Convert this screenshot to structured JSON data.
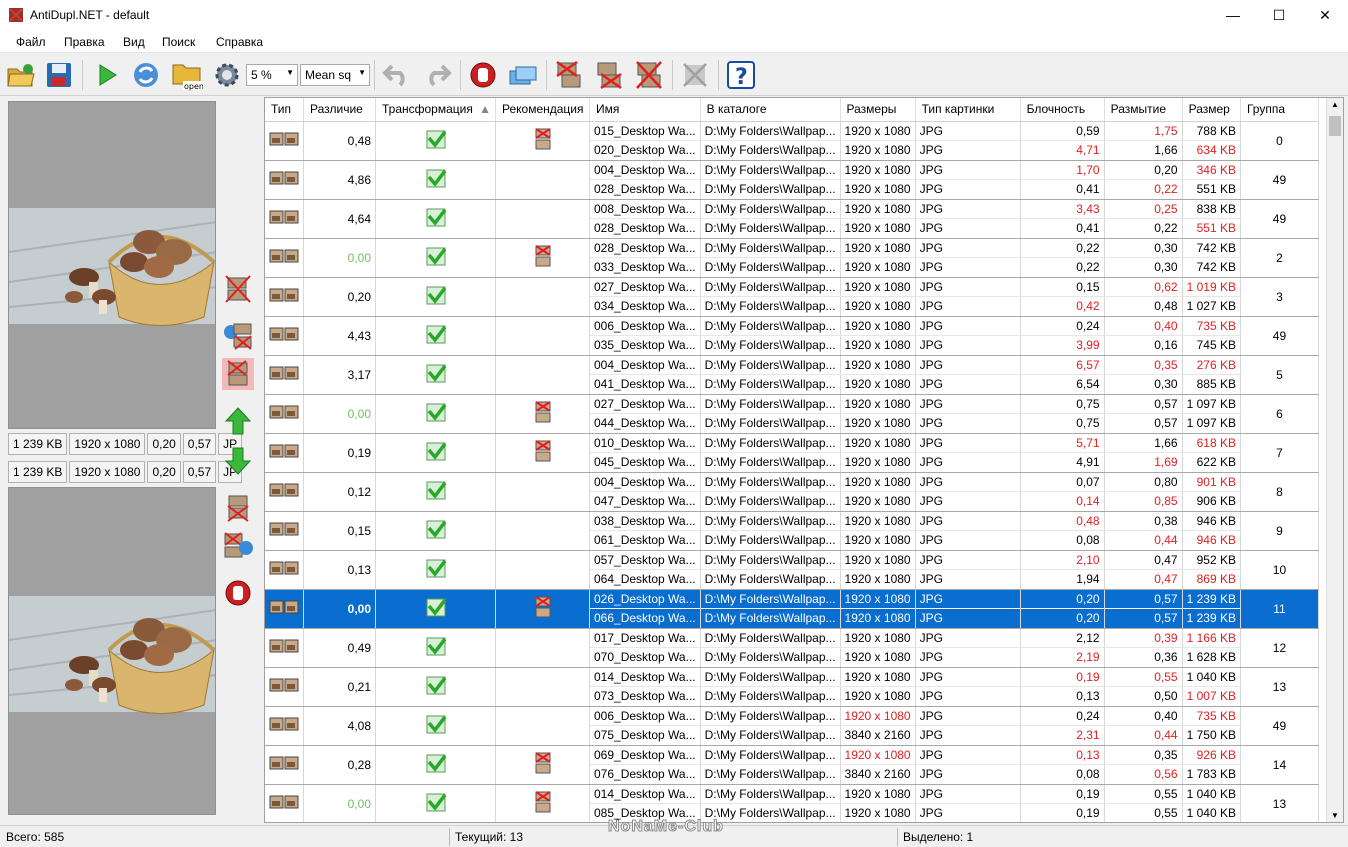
{
  "window": {
    "title": "AntiDupl.NET - default",
    "minimize": "—",
    "maximize": "☐",
    "close": "✕"
  },
  "menu": [
    "Файл",
    "Правка",
    "Вид",
    "Поиск",
    "Справка"
  ],
  "toolbar": {
    "threshold": "5 %",
    "algorithm": "Mean sq",
    "open_label": "open"
  },
  "left": {
    "top_info": [
      "1 239 KB",
      "1920 x 1080",
      "0,20",
      "0,57",
      "JP"
    ],
    "bottom_info": [
      "1 239 KB",
      "1920 x 1080",
      "0,20",
      "0,57",
      "JP"
    ]
  },
  "columns": [
    "Тип",
    "Различие",
    "Трансформация",
    "Рекомендация",
    "Имя",
    "В каталоге",
    "Размеры",
    "Тип картинки",
    "Блочность",
    "Размытие",
    "Размер",
    "Группа"
  ],
  "groups": [
    {
      "diff": "0,48",
      "dg": false,
      "rec": true,
      "group": "0",
      "sel": false,
      "a": {
        "name": "015_Desktop  Wa...",
        "dir": "D:\\My  Folders\\Wallpap...",
        "dim": "1920 x 1080",
        "dimr": false,
        "type": "JPG",
        "bl": "0,59",
        "blr": false,
        "bu": "1,75",
        "bur": true,
        "sz": "788 KB",
        "szr": false
      },
      "b": {
        "name": "020_Desktop  Wa...",
        "dir": "D:\\My  Folders\\Wallpap...",
        "dim": "1920 x 1080",
        "dimr": false,
        "type": "JPG",
        "bl": "4,71",
        "blr": true,
        "bu": "1,66",
        "bur": false,
        "sz": "634 KB",
        "szr": true
      }
    },
    {
      "diff": "4,86",
      "dg": false,
      "rec": false,
      "group": "49",
      "sel": false,
      "a": {
        "name": "004_Desktop  Wa...",
        "dir": "D:\\My  Folders\\Wallpap...",
        "dim": "1920 x 1080",
        "dimr": false,
        "type": "JPG",
        "bl": "1,70",
        "blr": true,
        "bu": "0,20",
        "bur": false,
        "sz": "346 KB",
        "szr": true
      },
      "b": {
        "name": "028_Desktop  Wa...",
        "dir": "D:\\My  Folders\\Wallpap...",
        "dim": "1920 x 1080",
        "dimr": false,
        "type": "JPG",
        "bl": "0,41",
        "blr": false,
        "bu": "0,22",
        "bur": true,
        "sz": "551 KB",
        "szr": false
      }
    },
    {
      "diff": "4,64",
      "dg": false,
      "rec": false,
      "group": "49",
      "sel": false,
      "a": {
        "name": "008_Desktop  Wa...",
        "dir": "D:\\My  Folders\\Wallpap...",
        "dim": "1920 x 1080",
        "dimr": false,
        "type": "JPG",
        "bl": "3,43",
        "blr": true,
        "bu": "0,25",
        "bur": true,
        "sz": "838 KB",
        "szr": false
      },
      "b": {
        "name": "028_Desktop  Wa...",
        "dir": "D:\\My  Folders\\Wallpap...",
        "dim": "1920 x 1080",
        "dimr": false,
        "type": "JPG",
        "bl": "0,41",
        "blr": false,
        "bu": "0,22",
        "bur": false,
        "sz": "551 KB",
        "szr": true
      }
    },
    {
      "diff": "0,00",
      "dg": true,
      "rec": true,
      "group": "2",
      "sel": false,
      "a": {
        "name": "028_Desktop  Wa...",
        "dir": "D:\\My  Folders\\Wallpap...",
        "dim": "1920 x 1080",
        "dimr": false,
        "type": "JPG",
        "bl": "0,22",
        "blr": false,
        "bu": "0,30",
        "bur": false,
        "sz": "742 KB",
        "szr": false
      },
      "b": {
        "name": "033_Desktop  Wa...",
        "dir": "D:\\My  Folders\\Wallpap...",
        "dim": "1920 x 1080",
        "dimr": false,
        "type": "JPG",
        "bl": "0,22",
        "blr": false,
        "bu": "0,30",
        "bur": false,
        "sz": "742 KB",
        "szr": false
      }
    },
    {
      "diff": "0,20",
      "dg": false,
      "rec": false,
      "group": "3",
      "sel": false,
      "a": {
        "name": "027_Desktop  Wa...",
        "dir": "D:\\My  Folders\\Wallpap...",
        "dim": "1920 x 1080",
        "dimr": false,
        "type": "JPG",
        "bl": "0,15",
        "blr": false,
        "bu": "0,62",
        "bur": true,
        "sz": "1 019 KB",
        "szr": true
      },
      "b": {
        "name": "034_Desktop  Wa...",
        "dir": "D:\\My  Folders\\Wallpap...",
        "dim": "1920 x 1080",
        "dimr": false,
        "type": "JPG",
        "bl": "0,42",
        "blr": true,
        "bu": "0,48",
        "bur": false,
        "sz": "1 027 KB",
        "szr": false
      }
    },
    {
      "diff": "4,43",
      "dg": false,
      "rec": false,
      "group": "49",
      "sel": false,
      "a": {
        "name": "006_Desktop  Wa...",
        "dir": "D:\\My  Folders\\Wallpap...",
        "dim": "1920 x 1080",
        "dimr": false,
        "type": "JPG",
        "bl": "0,24",
        "blr": false,
        "bu": "0,40",
        "bur": true,
        "sz": "735 KB",
        "szr": true
      },
      "b": {
        "name": "035_Desktop  Wa...",
        "dir": "D:\\My  Folders\\Wallpap...",
        "dim": "1920 x 1080",
        "dimr": false,
        "type": "JPG",
        "bl": "3,99",
        "blr": true,
        "bu": "0,16",
        "bur": false,
        "sz": "745 KB",
        "szr": false
      }
    },
    {
      "diff": "3,17",
      "dg": false,
      "rec": false,
      "group": "5",
      "sel": false,
      "a": {
        "name": "004_Desktop  Wa...",
        "dir": "D:\\My  Folders\\Wallpap...",
        "dim": "1920 x 1080",
        "dimr": false,
        "type": "JPG",
        "bl": "6,57",
        "blr": true,
        "bu": "0,35",
        "bur": true,
        "sz": "276 KB",
        "szr": true
      },
      "b": {
        "name": "041_Desktop  Wa...",
        "dir": "D:\\My  Folders\\Wallpap...",
        "dim": "1920 x 1080",
        "dimr": false,
        "type": "JPG",
        "bl": "6,54",
        "blr": false,
        "bu": "0,30",
        "bur": false,
        "sz": "885 KB",
        "szr": false
      }
    },
    {
      "diff": "0,00",
      "dg": true,
      "rec": true,
      "group": "6",
      "sel": false,
      "a": {
        "name": "027_Desktop  Wa...",
        "dir": "D:\\My  Folders\\Wallpap...",
        "dim": "1920 x 1080",
        "dimr": false,
        "type": "JPG",
        "bl": "0,75",
        "blr": false,
        "bu": "0,57",
        "bur": false,
        "sz": "1 097 KB",
        "szr": false
      },
      "b": {
        "name": "044_Desktop  Wa...",
        "dir": "D:\\My  Folders\\Wallpap...",
        "dim": "1920 x 1080",
        "dimr": false,
        "type": "JPG",
        "bl": "0,75",
        "blr": false,
        "bu": "0,57",
        "bur": false,
        "sz": "1 097 KB",
        "szr": false
      }
    },
    {
      "diff": "0,19",
      "dg": false,
      "rec": true,
      "group": "7",
      "sel": false,
      "a": {
        "name": "010_Desktop  Wa...",
        "dir": "D:\\My  Folders\\Wallpap...",
        "dim": "1920 x 1080",
        "dimr": false,
        "type": "JPG",
        "bl": "5,71",
        "blr": true,
        "bu": "1,66",
        "bur": false,
        "sz": "618 KB",
        "szr": true
      },
      "b": {
        "name": "045_Desktop  Wa...",
        "dir": "D:\\My  Folders\\Wallpap...",
        "dim": "1920 x 1080",
        "dimr": false,
        "type": "JPG",
        "bl": "4,91",
        "blr": false,
        "bu": "1,69",
        "bur": true,
        "sz": "622 KB",
        "szr": false
      }
    },
    {
      "diff": "0,12",
      "dg": false,
      "rec": false,
      "group": "8",
      "sel": false,
      "a": {
        "name": "004_Desktop  Wa...",
        "dir": "D:\\My  Folders\\Wallpap...",
        "dim": "1920 x 1080",
        "dimr": false,
        "type": "JPG",
        "bl": "0,07",
        "blr": false,
        "bu": "0,80",
        "bur": false,
        "sz": "901 KB",
        "szr": true
      },
      "b": {
        "name": "047_Desktop  Wa...",
        "dir": "D:\\My  Folders\\Wallpap...",
        "dim": "1920 x 1080",
        "dimr": false,
        "type": "JPG",
        "bl": "0,14",
        "blr": true,
        "bu": "0,85",
        "bur": true,
        "sz": "906 KB",
        "szr": false
      }
    },
    {
      "diff": "0,15",
      "dg": false,
      "rec": false,
      "group": "9",
      "sel": false,
      "a": {
        "name": "038_Desktop  Wa...",
        "dir": "D:\\My  Folders\\Wallpap...",
        "dim": "1920 x 1080",
        "dimr": false,
        "type": "JPG",
        "bl": "0,48",
        "blr": true,
        "bu": "0,38",
        "bur": false,
        "sz": "946 KB",
        "szr": false
      },
      "b": {
        "name": "061_Desktop  Wa...",
        "dir": "D:\\My  Folders\\Wallpap...",
        "dim": "1920 x 1080",
        "dimr": false,
        "type": "JPG",
        "bl": "0,08",
        "blr": false,
        "bu": "0,44",
        "bur": true,
        "sz": "946 KB",
        "szr": true
      }
    },
    {
      "diff": "0,13",
      "dg": false,
      "rec": false,
      "group": "10",
      "sel": false,
      "a": {
        "name": "057_Desktop  Wa...",
        "dir": "D:\\My  Folders\\Wallpap...",
        "dim": "1920 x 1080",
        "dimr": false,
        "type": "JPG",
        "bl": "2,10",
        "blr": true,
        "bu": "0,47",
        "bur": false,
        "sz": "952 KB",
        "szr": false
      },
      "b": {
        "name": "064_Desktop  Wa...",
        "dir": "D:\\My  Folders\\Wallpap...",
        "dim": "1920 x 1080",
        "dimr": false,
        "type": "JPG",
        "bl": "1,94",
        "blr": false,
        "bu": "0,47",
        "bur": true,
        "sz": "869 KB",
        "szr": true
      }
    },
    {
      "diff": "0,00",
      "dg": true,
      "rec": true,
      "group": "11",
      "sel": true,
      "a": {
        "name": "026_Desktop  Wa...",
        "dir": "D:\\My  Folders\\Wallpap...",
        "dim": "1920 x 1080",
        "dimr": false,
        "type": "JPG",
        "bl": "0,20",
        "blr": false,
        "bu": "0,57",
        "bur": false,
        "sz": "1 239 KB",
        "szr": false
      },
      "b": {
        "name": "066_Desktop  Wa...",
        "dir": "D:\\My  Folders\\Wallpap...",
        "dim": "1920 x 1080",
        "dimr": false,
        "type": "JPG",
        "bl": "0,20",
        "blr": false,
        "bu": "0,57",
        "bur": false,
        "sz": "1 239 KB",
        "szr": false
      }
    },
    {
      "diff": "0,49",
      "dg": false,
      "rec": false,
      "group": "12",
      "sel": false,
      "a": {
        "name": "017_Desktop  Wa...",
        "dir": "D:\\My  Folders\\Wallpap...",
        "dim": "1920 x 1080",
        "dimr": false,
        "type": "JPG",
        "bl": "2,12",
        "blr": false,
        "bu": "0,39",
        "bur": true,
        "sz": "1 166 KB",
        "szr": true
      },
      "b": {
        "name": "070_Desktop  Wa...",
        "dir": "D:\\My  Folders\\Wallpap...",
        "dim": "1920 x 1080",
        "dimr": false,
        "type": "JPG",
        "bl": "2,19",
        "blr": true,
        "bu": "0,36",
        "bur": false,
        "sz": "1 628 KB",
        "szr": false
      }
    },
    {
      "diff": "0,21",
      "dg": false,
      "rec": false,
      "group": "13",
      "sel": false,
      "a": {
        "name": "014_Desktop  Wa...",
        "dir": "D:\\My  Folders\\Wallpap...",
        "dim": "1920 x 1080",
        "dimr": false,
        "type": "JPG",
        "bl": "0,19",
        "blr": true,
        "bu": "0,55",
        "bur": true,
        "sz": "1 040 KB",
        "szr": false
      },
      "b": {
        "name": "073_Desktop  Wa...",
        "dir": "D:\\My  Folders\\Wallpap...",
        "dim": "1920 x 1080",
        "dimr": false,
        "type": "JPG",
        "bl": "0,13",
        "blr": false,
        "bu": "0,50",
        "bur": false,
        "sz": "1 007 KB",
        "szr": true
      }
    },
    {
      "diff": "4,08",
      "dg": false,
      "rec": false,
      "group": "49",
      "sel": false,
      "a": {
        "name": "006_Desktop  Wa...",
        "dir": "D:\\My  Folders\\Wallpap...",
        "dim": "1920 x 1080",
        "dimr": true,
        "type": "JPG",
        "bl": "0,24",
        "blr": false,
        "bu": "0,40",
        "bur": false,
        "sz": "735 KB",
        "szr": true
      },
      "b": {
        "name": "075_Desktop  Wa...",
        "dir": "D:\\My  Folders\\Wallpap...",
        "dim": "3840 x 2160",
        "dimr": false,
        "type": "JPG",
        "bl": "2,31",
        "blr": true,
        "bu": "0,44",
        "bur": true,
        "sz": "1 750 KB",
        "szr": false
      }
    },
    {
      "diff": "0,28",
      "dg": false,
      "rec": true,
      "group": "14",
      "sel": false,
      "a": {
        "name": "069_Desktop  Wa...",
        "dir": "D:\\My  Folders\\Wallpap...",
        "dim": "1920 x 1080",
        "dimr": true,
        "type": "JPG",
        "bl": "0,13",
        "blr": true,
        "bu": "0,35",
        "bur": false,
        "sz": "926 KB",
        "szr": true
      },
      "b": {
        "name": "076_Desktop  Wa...",
        "dir": "D:\\My  Folders\\Wallpap...",
        "dim": "3840 x 2160",
        "dimr": false,
        "type": "JPG",
        "bl": "0,08",
        "blr": false,
        "bu": "0,56",
        "bur": true,
        "sz": "1 783 KB",
        "szr": false
      }
    },
    {
      "diff": "0,00",
      "dg": true,
      "rec": true,
      "group": "13",
      "sel": false,
      "a": {
        "name": "014_Desktop  Wa...",
        "dir": "D:\\My  Folders\\Wallpap...",
        "dim": "1920 x 1080",
        "dimr": false,
        "type": "JPG",
        "bl": "0,19",
        "blr": false,
        "bu": "0,55",
        "bur": false,
        "sz": "1 040 KB",
        "szr": false
      },
      "b": {
        "name": "085_Desktop  Wa...",
        "dir": "D:\\My  Folders\\Wallpap...",
        "dim": "1920 x 1080",
        "dimr": false,
        "type": "JPG",
        "bl": "0,19",
        "blr": false,
        "bu": "0,55",
        "bur": false,
        "sz": "1 040 KB",
        "szr": false
      }
    }
  ],
  "status": {
    "total": "Всего: 585",
    "current": "Текущий: 13",
    "selected": "Выделено: 1"
  },
  "watermark": "NoNaMe-Club"
}
